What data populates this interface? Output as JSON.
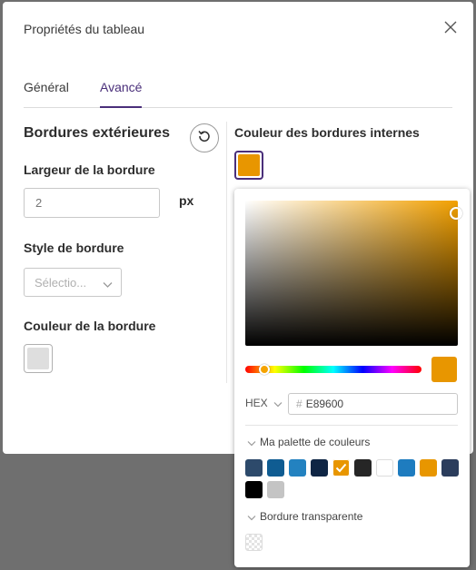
{
  "dialog": {
    "title": "Propriétés du tableau",
    "close_icon": "close-icon"
  },
  "tabs": [
    {
      "label": "Général",
      "active": false
    },
    {
      "label": "Avancé",
      "active": true
    }
  ],
  "outer_borders": {
    "heading": "Bordures extérieures",
    "reset_icon": "reset-icon",
    "width_label": "Largeur de la bordure",
    "width_placeholder": "2",
    "width_unit": "px",
    "style_label": "Style de bordure",
    "style_placeholder": "Sélectio...",
    "color_label": "Couleur de la bordure",
    "color_value": "#DEDEDE"
  },
  "inner_borders": {
    "heading": "Couleur des bordures internes",
    "color_value": "#E89600"
  },
  "color_picker": {
    "format_label": "HEX",
    "hex_prefix": "#",
    "hex_value": "E89600",
    "preview_color": "#E89600",
    "palette_title": "Ma palette de couleurs",
    "palette": [
      {
        "color": "#2D4A6B",
        "selected": false
      },
      {
        "color": "#0F5C92",
        "selected": false
      },
      {
        "color": "#2382C0",
        "selected": false
      },
      {
        "color": "#0E2544",
        "selected": false
      },
      {
        "color": "#E89600",
        "selected": true
      },
      {
        "color": "#262626",
        "selected": false
      },
      {
        "color": "#FFFFFF",
        "selected": false
      },
      {
        "color": "#1E7CBF",
        "selected": false
      },
      {
        "color": "#E89600",
        "selected": false
      },
      {
        "color": "#2B3D5C",
        "selected": false
      },
      {
        "color": "#000000",
        "selected": false
      },
      {
        "color": "#C4C4C4",
        "selected": false
      }
    ],
    "transparent_title": "Bordure transparente"
  },
  "colors": {
    "accent": "#4A2F7A",
    "backdrop": "#6F6F6F"
  }
}
